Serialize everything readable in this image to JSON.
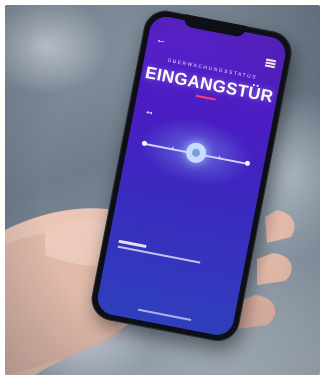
{
  "app": {
    "subheading": "ÜBERWACHUNGSSTATUS",
    "title": "EINGANGSTÜR",
    "accent_color": "#ff3d6e"
  },
  "icons": {
    "back": "←",
    "menu": "menu-icon"
  },
  "colors": {
    "screen_top": "#5a21c9",
    "screen_bottom": "#2f3fbd",
    "phone_body": "#0d0f14"
  }
}
